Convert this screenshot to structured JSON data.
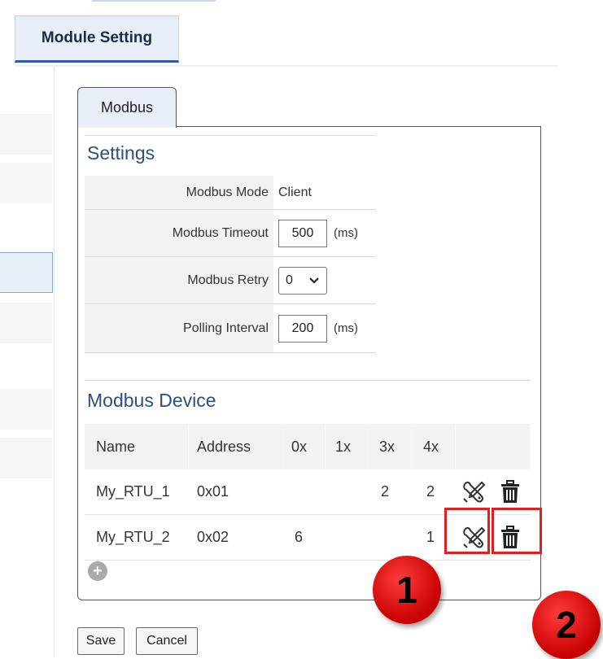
{
  "header": {
    "module_tab": "Module Setting"
  },
  "tabs": [
    {
      "label": "Modbus"
    }
  ],
  "settings": {
    "title": "Settings",
    "modbus_mode": {
      "label": "Modbus Mode",
      "value": "Client"
    },
    "modbus_timeout": {
      "label": "Modbus Timeout",
      "value": "500",
      "unit": "(ms)"
    },
    "modbus_retry": {
      "label": "Modbus Retry",
      "value": "0"
    },
    "polling_interval": {
      "label": "Polling Interval",
      "value": "200",
      "unit": "(ms)"
    }
  },
  "devices": {
    "title": "Modbus Device",
    "columns": [
      "Name",
      "Address",
      "0x",
      "1x",
      "3x",
      "4x"
    ],
    "rows": [
      {
        "name": "My_RTU_1",
        "address": "0x01",
        "c0x": "",
        "c1x": "",
        "c3x": "2",
        "c4x": "2"
      },
      {
        "name": "My_RTU_2",
        "address": "0x02",
        "c0x": "6",
        "c1x": "",
        "c3x": "",
        "c4x": "1"
      }
    ]
  },
  "annotations": {
    "badge1": "1",
    "badge2": "2",
    "highlight_color": "#e02020"
  },
  "icons": {
    "edit": "wrench-screwdriver-icon",
    "delete": "trash-icon",
    "add": "plus-circle-icon"
  },
  "footer": {
    "save_label": "Save",
    "cancel_label": "Cancel"
  }
}
